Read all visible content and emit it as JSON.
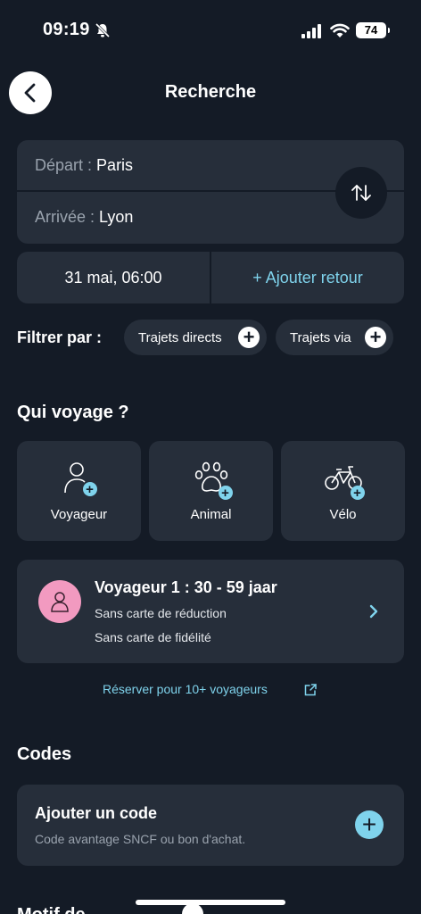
{
  "status": {
    "time": "09:19",
    "battery": "74"
  },
  "header": {
    "title": "Recherche"
  },
  "route": {
    "departure_label": "Départ :",
    "departure_value": "Paris",
    "arrival_label": "Arrivée :",
    "arrival_value": "Lyon"
  },
  "dates": {
    "outbound": "31 mai, 06:00",
    "add_return": "+ Ajouter retour"
  },
  "filters": {
    "label": "Filtrer par :",
    "chips": [
      {
        "label": "Trajets directs"
      },
      {
        "label": "Trajets via"
      }
    ]
  },
  "who": {
    "title": "Qui voyage ?",
    "tiles": [
      {
        "label": "Voyageur"
      },
      {
        "label": "Animal"
      },
      {
        "label": "Vélo"
      }
    ]
  },
  "passenger": {
    "title": "Voyageur 1 : 30 - 59 jaar",
    "reduction": "Sans carte de réduction",
    "fidelity": "Sans carte de fidélité",
    "avatar_color": "#f29ac0"
  },
  "reserve_link": "Réserver pour 10+ voyageurs",
  "codes": {
    "title": "Codes",
    "card_title": "Ajouter un code",
    "card_subtitle": "Code avantage SNCF ou bon d'achat."
  },
  "bottom_section_title": "Motif de",
  "colors": {
    "background": "#141b26",
    "card": "#262e3a",
    "accent": "#7fd3ec"
  }
}
